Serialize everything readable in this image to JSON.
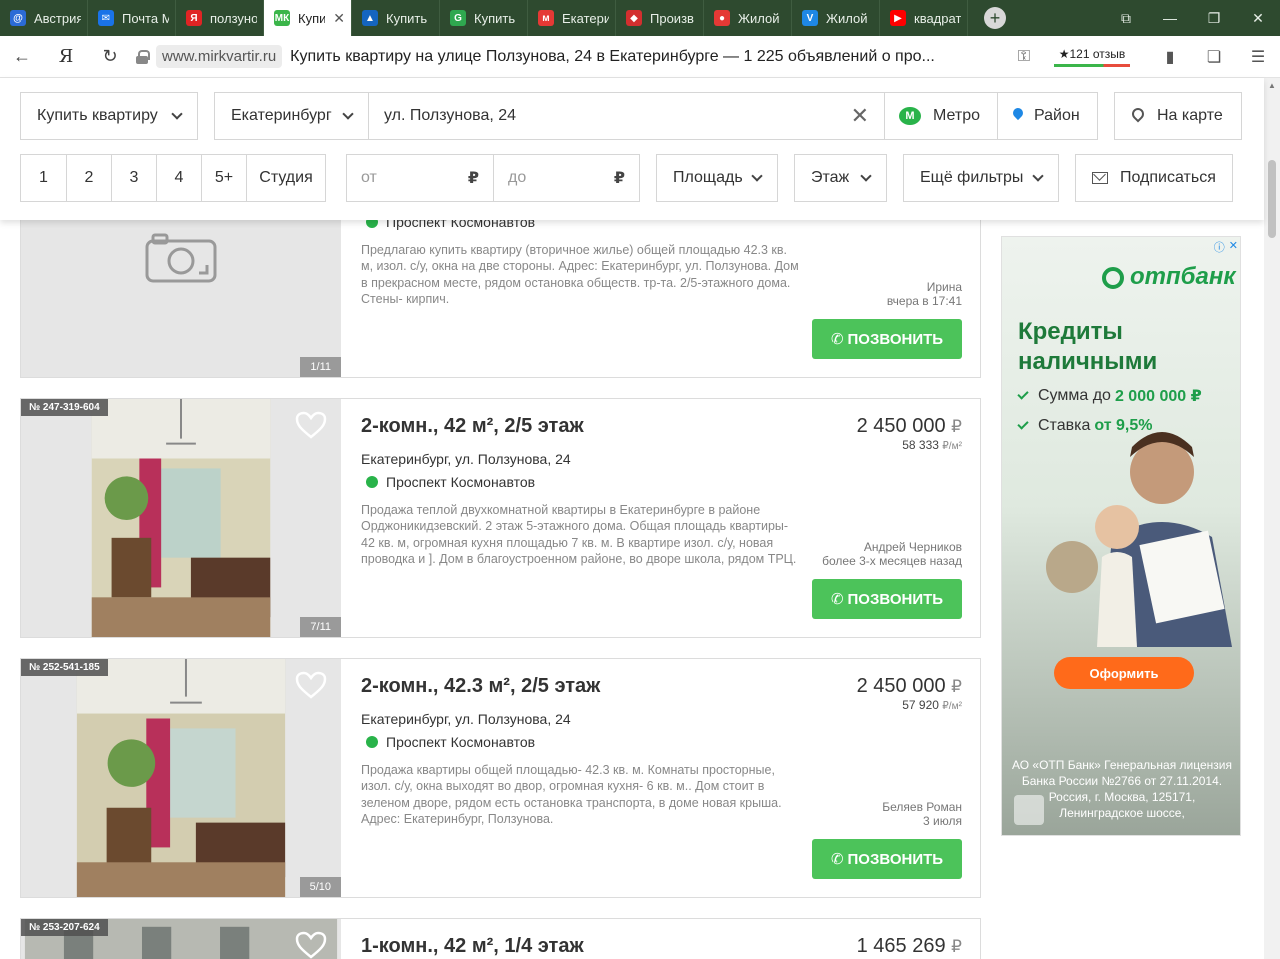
{
  "browser": {
    "tabs": [
      {
        "label": "Австрия",
        "icon": "at-icon",
        "color": "#2b6bd6",
        "glyph": "@"
      },
      {
        "label": "Почта М",
        "icon": "mail-icon",
        "color": "#1a73e8",
        "glyph": "✉"
      },
      {
        "label": "ползуно",
        "icon": "yandex-icon",
        "color": "#e02424",
        "glyph": "Я"
      },
      {
        "label": "Купи",
        "icon": "mk-icon",
        "color": "#3bb54a",
        "glyph": "МК",
        "active": true
      },
      {
        "label": "Купить",
        "icon": "arrow-logo-icon",
        "color": "#1565c0",
        "glyph": "▲"
      },
      {
        "label": "Купить",
        "icon": "g-logo-icon",
        "color": "#2fa84f",
        "glyph": "G"
      },
      {
        "label": "Екатери",
        "icon": "metr-icon",
        "color": "#e53935",
        "glyph": "м"
      },
      {
        "label": "Произв",
        "icon": "diamond-icon",
        "color": "#d32f2f",
        "glyph": "◆"
      },
      {
        "label": "Жилой",
        "icon": "map-pin-icon",
        "color": "#e53935",
        "glyph": "●"
      },
      {
        "label": "Жилой",
        "icon": "vit-icon",
        "color": "#1e88e5",
        "glyph": "V"
      },
      {
        "label": "квадрат",
        "icon": "youtube-icon",
        "color": "#ff0000",
        "glyph": "▶"
      }
    ],
    "domain": "www.mirkvartir.ru",
    "page_title": "Купить квартиру на улице Ползунова, 24 в Екатеринбурге — 1 225 объявлений о про...",
    "reviews_label": "★121 отзыв"
  },
  "filters": {
    "deal": "Купить квартиру",
    "city": "Екатеринбург",
    "street": "ул. Ползунова, 24",
    "metro": "Метро",
    "district": "Район",
    "map": "На карте",
    "rooms": [
      "1",
      "2",
      "3",
      "4",
      "5+",
      "Студия"
    ],
    "price_from_placeholder": "от",
    "price_to_placeholder": "до",
    "currency": "₽",
    "area": "Площадь",
    "floor": "Этаж",
    "more": "Ещё фильтры",
    "subscribe": "Подписаться"
  },
  "listings": [
    {
      "id_tag": "",
      "title": "",
      "address": "",
      "metro": "Проспект Космонавтов",
      "description": "Предлагаю купить квартиру (вторичное жилье) общей площадью 42.3 кв. м, изол. с/у, окна на две стороны. Адрес: Екатеринбург, ул. Ползунова. Дом в прекрасном месте, рядом остановка обществ. тр-та. 2/5-этажного дома. Стены- кирпич.",
      "price": "",
      "price_m2": "",
      "seller": "Ирина",
      "date": "вчера в 17:41",
      "photo_counter": "1/11",
      "call": "ПОЗВОНИТЬ"
    },
    {
      "id_tag": "№ 247-319-604",
      "title": "2-комн., 42 м², 2/5 этаж",
      "address": "Екатеринбург, ул. Ползунова, 24",
      "metro": "Проспект Космонавтов",
      "description": "Продажа теплой двухкомнатной квартиры в Екатеринбурге в районе Орджоникидзевский. 2 этаж 5-этажного дома. Общая площадь квартиры- 42 кв. м, огромная кухня площадью 7 кв. м. В квартире изол. с/у, новая проводка и ]. Дом в благоустроенном районе, во дворе школа, рядом ТРЦ.",
      "price": "2 450 000",
      "price_m2": "58 333",
      "seller": "Андрей Черников",
      "date": "более 3-х месяцев назад",
      "photo_counter": "7/11",
      "call": "ПОЗВОНИТЬ"
    },
    {
      "id_tag": "№ 252-541-185",
      "title": "2-комн., 42.3 м², 2/5 этаж",
      "address": "Екатеринбург, ул. Ползунова, 24",
      "metro": "Проспект Космонавтов",
      "description": "Продажа квартиры общей площадью- 42.3 кв. м. Комнаты просторные, изол. с/у, окна выходят во двор, огромная кухня- 6 кв. м.. Дом стоит в зеленом дворе, рядом есть остановка транспорта, в доме новая крыша. Адрес: Екатеринбург, Ползунова.",
      "price": "2 450 000",
      "price_m2": "57 920",
      "seller": "Беляев Роман",
      "date": "3 июля",
      "photo_counter": "5/10",
      "call": "ПОЗВОНИТЬ"
    },
    {
      "id_tag": "№ 253-207-624",
      "title": "1-комн., 42 м², 1/4 этаж",
      "price": "1 465 269"
    }
  ],
  "units": {
    "rub": "₽",
    "per_m2": "₽/м²"
  },
  "ad": {
    "brand": "отпбанк",
    "headline_1": "Кредиты",
    "headline_2": "наличными",
    "bullet_1_text": "Сумма до",
    "bullet_1_value": "2 000 000 ₽",
    "bullet_2_text": "Ставка",
    "bullet_2_value": "от 9,5%",
    "cta": "Оформить",
    "legal": "АО «ОТП Банк» Генеральная лицензия Банка России №2766 от 27.11.2014. Россия, г. Москва, 125171, Ленинградское шоссе,"
  }
}
